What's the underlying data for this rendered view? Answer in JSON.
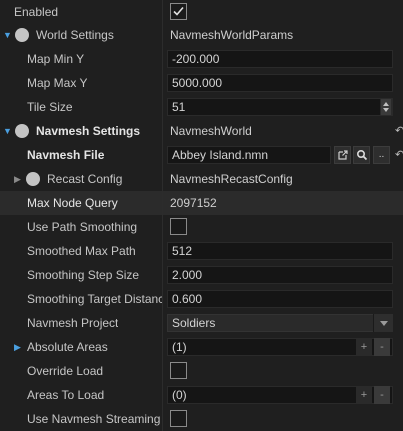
{
  "rows": {
    "enabled": {
      "label": "Enabled",
      "checked": true
    },
    "world_settings": {
      "label": "World Settings",
      "value": "NavmeshWorldParams"
    },
    "map_min_y": {
      "label": "Map Min Y",
      "value": "-200.000"
    },
    "map_max_y": {
      "label": "Map Max Y",
      "value": "5000.000"
    },
    "tile_size": {
      "label": "Tile Size",
      "value": "51"
    },
    "navmesh_settings": {
      "label": "Navmesh Settings",
      "value": "NavmeshWorld"
    },
    "navmesh_file": {
      "label": "Navmesh File",
      "value": "Abbey Island.nmn",
      "browse_label": "..",
      "revert_label": "↶"
    },
    "recast_config": {
      "label": "Recast Config",
      "value": "NavmeshRecastConfig"
    },
    "max_node_query": {
      "label": "Max Node Query",
      "value": "2097152"
    },
    "use_path_smoothing": {
      "label": "Use Path Smoothing",
      "checked": false
    },
    "smoothed_max_path": {
      "label": "Smoothed Max Path",
      "value": "512"
    },
    "smoothing_step_size": {
      "label": "Smoothing Step Size",
      "value": "2.000"
    },
    "smoothing_target_distance": {
      "label": "Smoothing Target Distance",
      "value": "0.600"
    },
    "navmesh_project": {
      "label": "Navmesh Project",
      "value": "Soldiers"
    },
    "absolute_areas": {
      "label": "Absolute Areas",
      "value": "(1)",
      "add_label": "+",
      "remove_label": "-"
    },
    "override_load": {
      "label": "Override Load",
      "checked": false
    },
    "areas_to_load": {
      "label": "Areas To Load",
      "value": "(0)",
      "add_label": "+",
      "remove_label": "-"
    },
    "use_navmesh_streaming": {
      "label": "Use Navmesh Streaming",
      "checked": false
    }
  },
  "revert_glyph": "↶",
  "colors": {
    "background": "#1f1f1f",
    "highlight": "#2b2b2b",
    "accent": "#4a9fe0"
  }
}
